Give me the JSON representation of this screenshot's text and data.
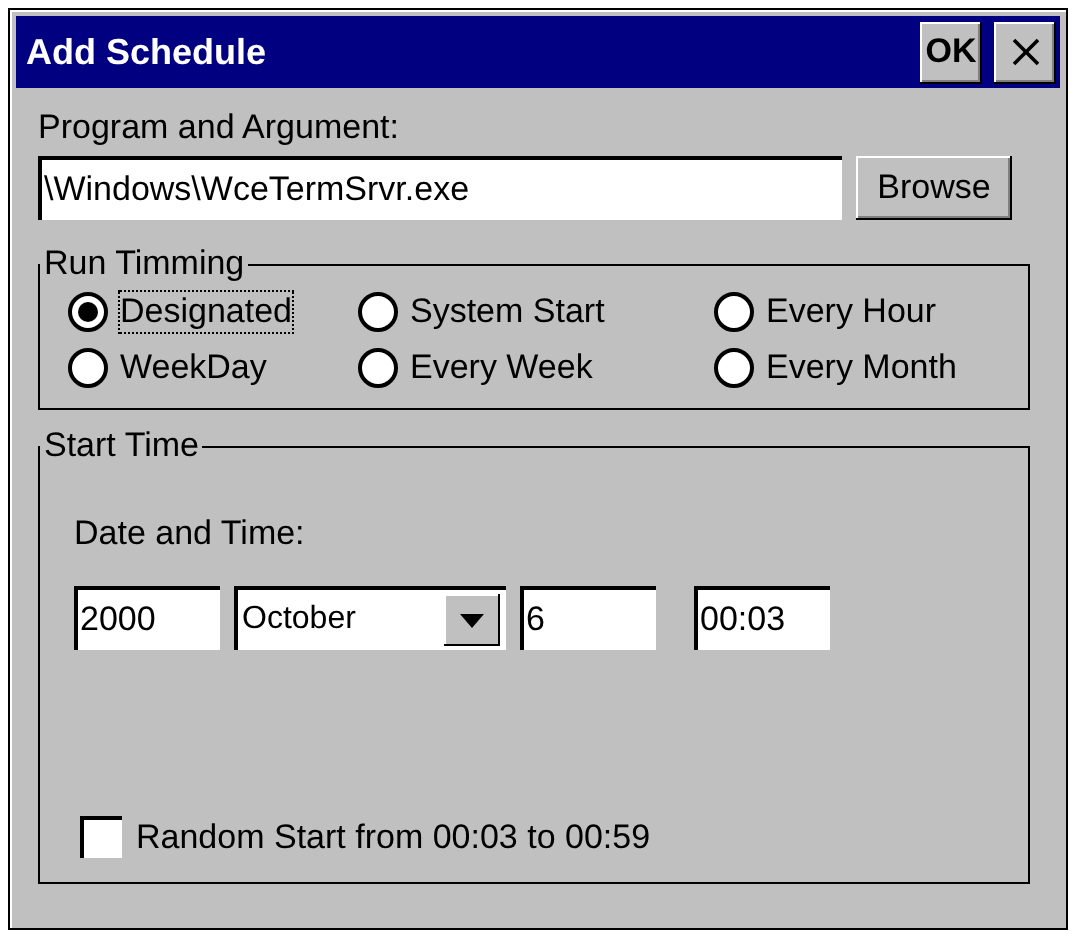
{
  "window": {
    "title": "Add Schedule",
    "buttons": [
      {
        "kind": "ok",
        "label": "OK"
      },
      {
        "kind": "close"
      }
    ]
  },
  "program": {
    "label": "Program and Argument:",
    "value": "\\Windows\\WceTermSrvr.exe",
    "button": "Browse"
  },
  "run_timming": {
    "title": "Run Timming",
    "options": [
      {
        "label": "Designated",
        "selected": true,
        "focused": true
      },
      {
        "label": "System Start",
        "selected": false,
        "focused": false
      },
      {
        "label": "Every Hour",
        "selected": false,
        "focused": false
      },
      {
        "label": "WeekDay",
        "selected": false,
        "focused": false
      },
      {
        "label": "Every Week",
        "selected": false,
        "focused": false
      },
      {
        "label": "Every Month",
        "selected": false,
        "focused": false
      }
    ]
  },
  "start_time": {
    "title": "Start Time",
    "label": "Date and Time:",
    "year": "2000",
    "month": "October",
    "day": "6",
    "time": "00:03",
    "random": {
      "label": "Random Start from 00:03 to 00:59",
      "checked": false
    }
  }
}
